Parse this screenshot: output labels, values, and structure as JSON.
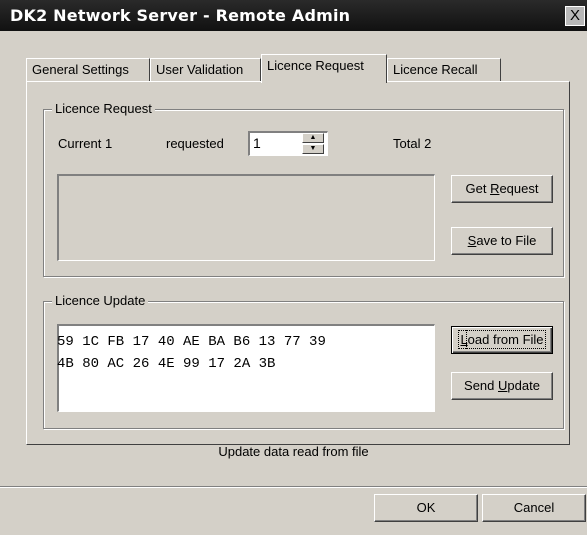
{
  "window": {
    "title": "DK2 Network Server - Remote Admin",
    "close_label": "X"
  },
  "tabs": [
    {
      "label": "General Settings"
    },
    {
      "label": "User Validation"
    },
    {
      "label": "Licence Request"
    },
    {
      "label": "Licence Recall"
    }
  ],
  "active_tab": "Licence Request",
  "licence_request": {
    "group_label": "Licence Request",
    "current_label": "Current 1",
    "requested_label": "requested",
    "requested_value": "1",
    "total_label": "Total 2",
    "request_text": "",
    "get_request_prefix": "Get ",
    "get_request_key": "R",
    "get_request_rest": "equest",
    "save_key": "S",
    "save_rest": "ave to File"
  },
  "licence_update": {
    "group_label": "Licence Update",
    "hex_line1": "59 1C FB 17 40 AE BA B6 13 77 39",
    "hex_line2": "4B 80 AC 26 4E 99 17 2A 3B",
    "load_key": "L",
    "load_rest": "oad from File",
    "send_prefix": "Send ",
    "send_key": "U",
    "send_rest": "pdate"
  },
  "status_text": "Update data read from file",
  "footer": {
    "ok_label": "OK",
    "cancel_label": "Cancel"
  },
  "icons": {
    "close": "close-icon",
    "spin_up": "spin-up-icon",
    "spin_down": "spin-down-icon"
  }
}
